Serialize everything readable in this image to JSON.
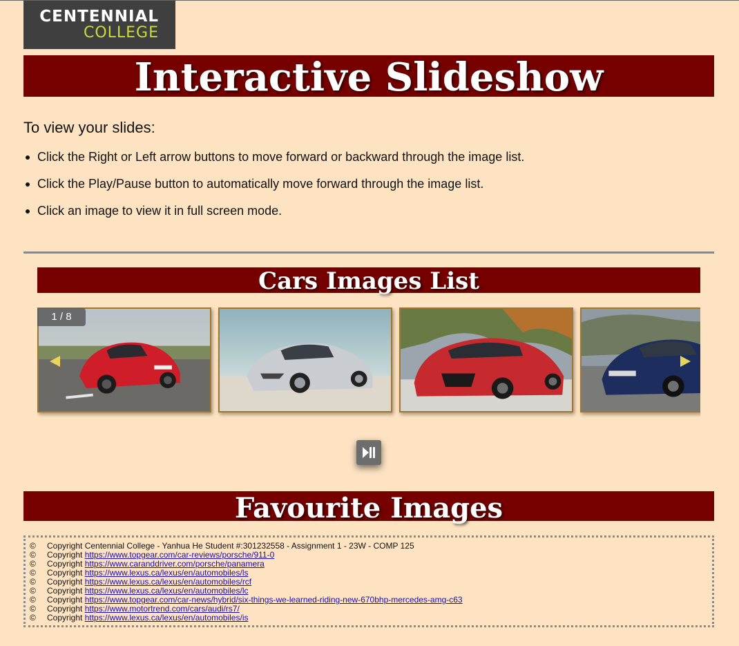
{
  "logo": {
    "line1": "CENTENNIAL",
    "line2": "COLLEGE"
  },
  "header": {
    "title": "Interactive Slideshow"
  },
  "intro": {
    "heading": "To view your slides:",
    "items": [
      "Click the Right or Left arrow buttons to move forward or backward through the image list.",
      "Click the Play/Pause button to automatically move forward through the image list.",
      "Click an image to view it in full screen mode."
    ]
  },
  "carousel": {
    "title": "Cars Images List",
    "counter": "1 / 8",
    "slides": [
      {
        "alt": "Red Porsche 911"
      },
      {
        "alt": "Silver Lexus IS"
      },
      {
        "alt": "Red Audi RS7"
      },
      {
        "alt": "Blue Porsche Panamera"
      }
    ],
    "icons": {
      "prev": "left-arrow-icon",
      "next": "right-arrow-icon",
      "play": "play-pause-icon"
    }
  },
  "favourites": {
    "title": "Favourite Images"
  },
  "footer": {
    "symbol": "©",
    "college_line": "Copyright Centennial College - Yanhua He Student #:301232558 - Assignment 1 - 23W - COMP 125",
    "prefix": "Copyright",
    "links": [
      "https://www.topgear.com/car-reviews/porsche/911-0",
      "https://www.caranddriver.com/porsche/panamera",
      "https://www.lexus.ca/lexus/en/automobiles/ls",
      "https://www.lexus.ca/lexus/en/automobiles/rcf",
      "https://www.lexus.ca/lexus/en/automobiles/lc",
      "https://www.topgear.com/car-news/hybrid/six-things-we-learned-riding-new-670bhp-mercedes-amg-c63",
      "https://www.motortrend.com/cars/audi/rs7/",
      "https://www.lexus.ca/lexus/en/automobiles/is"
    ]
  },
  "colors": {
    "background": "#fde3c2",
    "banner": "#760000",
    "logo_bg": "#3f3f3f",
    "logo_accent": "#c9dc3c",
    "arrow": "#e8d45a"
  }
}
